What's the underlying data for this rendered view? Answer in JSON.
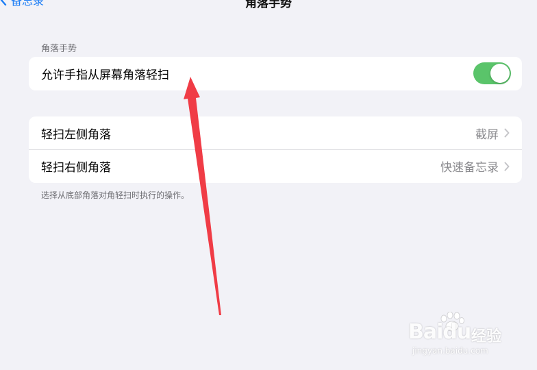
{
  "nav": {
    "back_label": "备忘录",
    "title": "角落手势"
  },
  "section": {
    "header": "角落手势"
  },
  "gesture_toggle": {
    "label": "允许手指从屏幕角落轻扫",
    "enabled": true
  },
  "corners": [
    {
      "label": "轻扫左侧角落",
      "value": "截屏"
    },
    {
      "label": "轻扫右侧角落",
      "value": "快速备忘录"
    }
  ],
  "footer_note": "选择从底部角落对角轻扫时执行的操作。",
  "watermark": {
    "logo": "Baidu",
    "text": "经验",
    "url": "jingyan.baidu.com"
  },
  "colors": {
    "accent": "#1a7cf5",
    "toggle_on": "#5ac46a",
    "background": "#f2f2f7",
    "annotation_arrow": "#f03c46"
  },
  "icons": {
    "back": "chevron-left-icon",
    "row": "chevron-right-icon"
  }
}
